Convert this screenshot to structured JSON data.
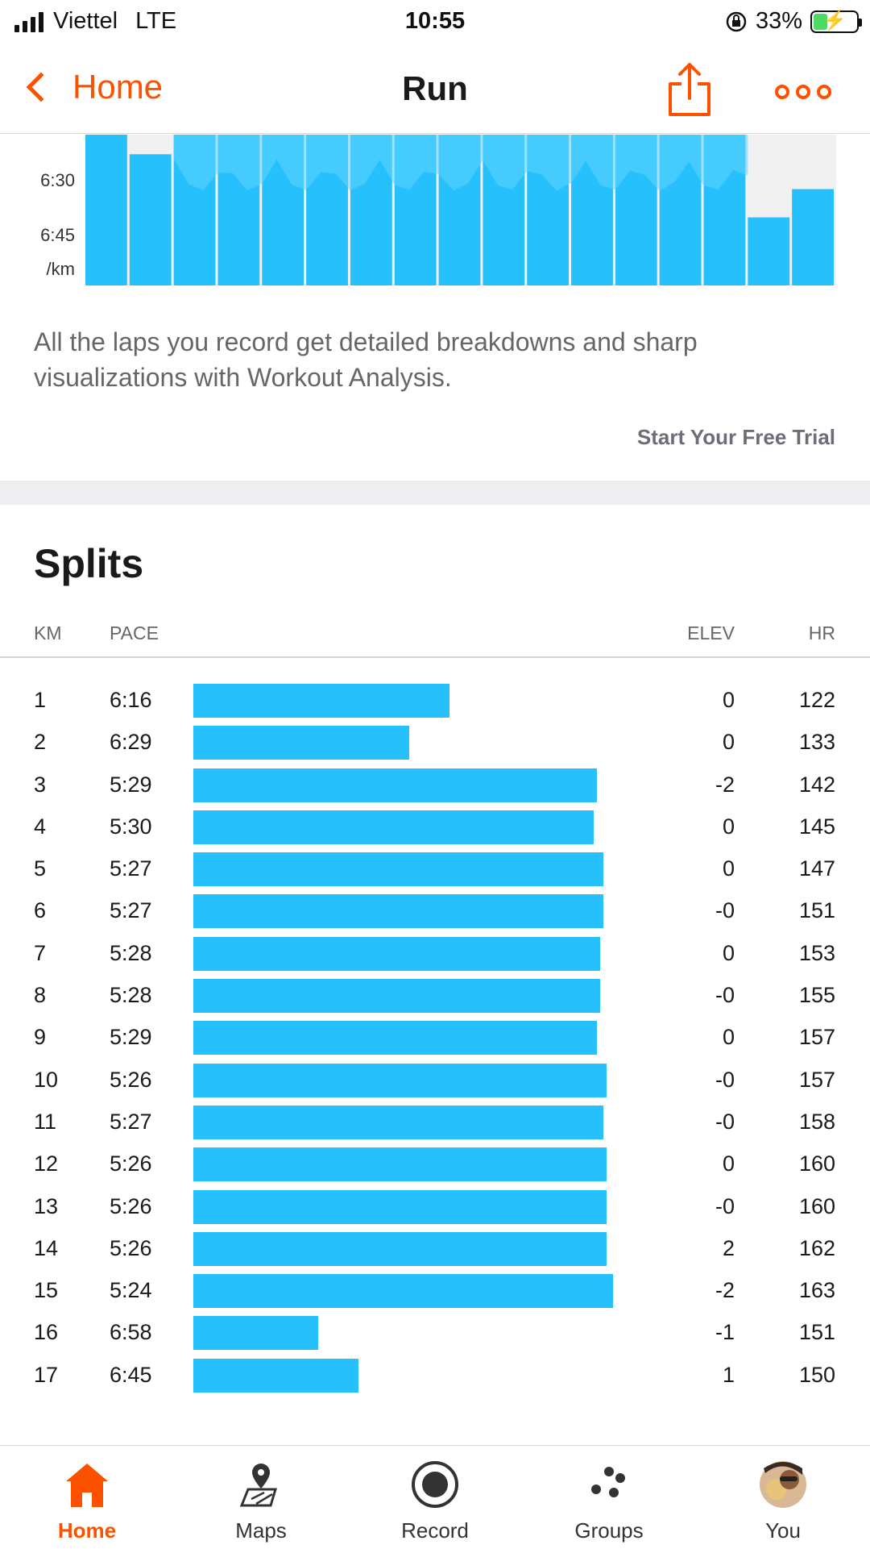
{
  "status_bar": {
    "carrier": "Viettel",
    "network": "LTE",
    "time": "10:55",
    "battery": "33%",
    "battery_level": 0.33
  },
  "nav": {
    "back_label": "Home",
    "title": "Run",
    "accent_color": "#fc5200"
  },
  "lap_chart": {
    "y_ticks": [
      "6:30",
      "6:45",
      "/km"
    ],
    "bar_color": "#26c0fc"
  },
  "promo": {
    "text": "All the laps you record get detailed breakdowns and sharp visualizations with Workout Analysis.",
    "trial_label": "Start Your Free Trial"
  },
  "splits": {
    "title": "Splits",
    "headers": {
      "km": "KM",
      "pace": "PACE",
      "elev": "ELEV",
      "hr": "HR"
    },
    "bar_color": "#26c0fc",
    "rows": [
      {
        "km": "1",
        "pace": "6:16",
        "elev": "0",
        "hr": "122"
      },
      {
        "km": "2",
        "pace": "6:29",
        "elev": "0",
        "hr": "133"
      },
      {
        "km": "3",
        "pace": "5:29",
        "elev": "-2",
        "hr": "142"
      },
      {
        "km": "4",
        "pace": "5:30",
        "elev": "0",
        "hr": "145"
      },
      {
        "km": "5",
        "pace": "5:27",
        "elev": "0",
        "hr": "147"
      },
      {
        "km": "6",
        "pace": "5:27",
        "elev": "-0",
        "hr": "151"
      },
      {
        "km": "7",
        "pace": "5:28",
        "elev": "0",
        "hr": "153"
      },
      {
        "km": "8",
        "pace": "5:28",
        "elev": "-0",
        "hr": "155"
      },
      {
        "km": "9",
        "pace": "5:29",
        "elev": "0",
        "hr": "157"
      },
      {
        "km": "10",
        "pace": "5:26",
        "elev": "-0",
        "hr": "157"
      },
      {
        "km": "11",
        "pace": "5:27",
        "elev": "-0",
        "hr": "158"
      },
      {
        "km": "12",
        "pace": "5:26",
        "elev": "0",
        "hr": "160"
      },
      {
        "km": "13",
        "pace": "5:26",
        "elev": "-0",
        "hr": "160"
      },
      {
        "km": "14",
        "pace": "5:26",
        "elev": "2",
        "hr": "162"
      },
      {
        "km": "15",
        "pace": "5:24",
        "elev": "-2",
        "hr": "163"
      },
      {
        "km": "16",
        "pace": "6:58",
        "elev": "-1",
        "hr": "151"
      },
      {
        "km": "17",
        "pace": "6:45",
        "elev": "1",
        "hr": "150"
      }
    ]
  },
  "tabs": [
    {
      "id": "home",
      "label": "Home",
      "icon": "home-icon",
      "active": true
    },
    {
      "id": "maps",
      "label": "Maps",
      "icon": "map-pin-icon",
      "active": false
    },
    {
      "id": "record",
      "label": "Record",
      "icon": "record-icon",
      "active": false
    },
    {
      "id": "groups",
      "label": "Groups",
      "icon": "groups-icon",
      "active": false
    },
    {
      "id": "you",
      "label": "You",
      "icon": "avatar",
      "active": false
    }
  ]
}
